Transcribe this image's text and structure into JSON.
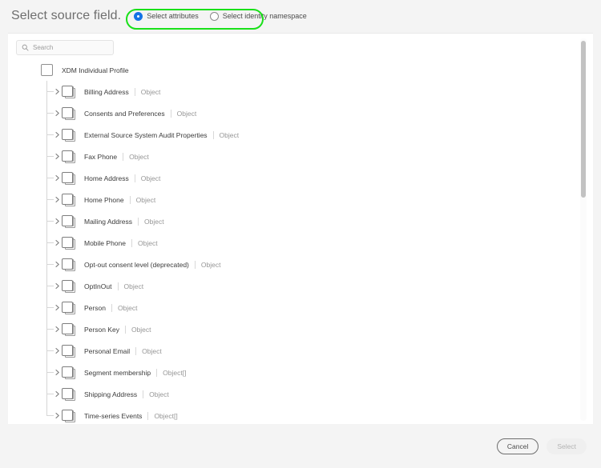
{
  "header": {
    "title": "Select source field.",
    "mode_options": [
      {
        "label": "Select attributes",
        "selected": true
      },
      {
        "label": "Select identity namespace",
        "selected": false
      }
    ],
    "annotation_color": "#19e019",
    "accent_color": "#1473e6"
  },
  "search": {
    "placeholder": "Search",
    "value": "",
    "icon": "search-icon"
  },
  "tree": {
    "root": {
      "label": "XDM Individual Profile",
      "checked": false
    },
    "nodes": [
      {
        "label": "Billing Address",
        "type": "Object"
      },
      {
        "label": "Consents and Preferences",
        "type": "Object"
      },
      {
        "label": "External Source System Audit Properties",
        "type": "Object"
      },
      {
        "label": "Fax Phone",
        "type": "Object"
      },
      {
        "label": "Home Address",
        "type": "Object"
      },
      {
        "label": "Home Phone",
        "type": "Object"
      },
      {
        "label": "Mailing Address",
        "type": "Object"
      },
      {
        "label": "Mobile Phone",
        "type": "Object"
      },
      {
        "label": "Opt-out consent level (deprecated)",
        "type": "Object"
      },
      {
        "label": "OptInOut",
        "type": "Object"
      },
      {
        "label": "Person",
        "type": "Object"
      },
      {
        "label": "Person Key",
        "type": "Object"
      },
      {
        "label": "Personal Email",
        "type": "Object"
      },
      {
        "label": "Segment membership",
        "type": "Object[]"
      },
      {
        "label": "Shipping Address",
        "type": "Object"
      },
      {
        "label": "Time-series Events",
        "type": "Object[]"
      }
    ]
  },
  "footer": {
    "cancel_label": "Cancel",
    "select_label": "Select",
    "select_disabled": true
  }
}
